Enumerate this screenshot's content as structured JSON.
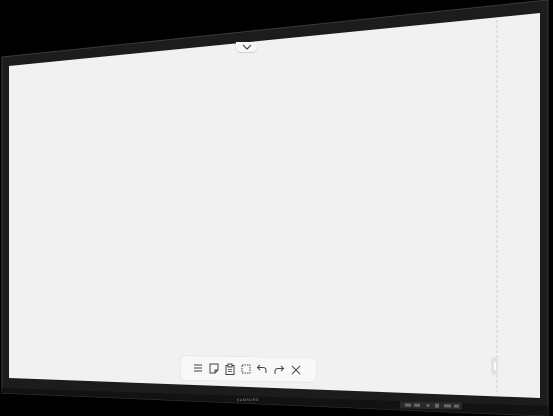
{
  "device": {
    "brand": "SAMSUNG",
    "colors": {
      "background": "#000000",
      "bezel": "#1c1c1c",
      "screen": "#f1f1f1",
      "icon": "#444444"
    }
  },
  "whiteboard": {
    "top_panel_toggle_icon": "chevron-down-icon",
    "side_panel_handle_icon": "grip-handle-icon",
    "toolbar": [
      {
        "name": "menu",
        "icon": "menu-icon"
      },
      {
        "name": "sticky-note",
        "icon": "sticky-note-icon"
      },
      {
        "name": "copy-paste",
        "icon": "clipboard-icon"
      },
      {
        "name": "select",
        "icon": "select-marquee-icon"
      },
      {
        "name": "undo",
        "icon": "undo-icon"
      },
      {
        "name": "redo",
        "icon": "redo-icon"
      },
      {
        "name": "close",
        "icon": "close-icon"
      }
    ]
  }
}
